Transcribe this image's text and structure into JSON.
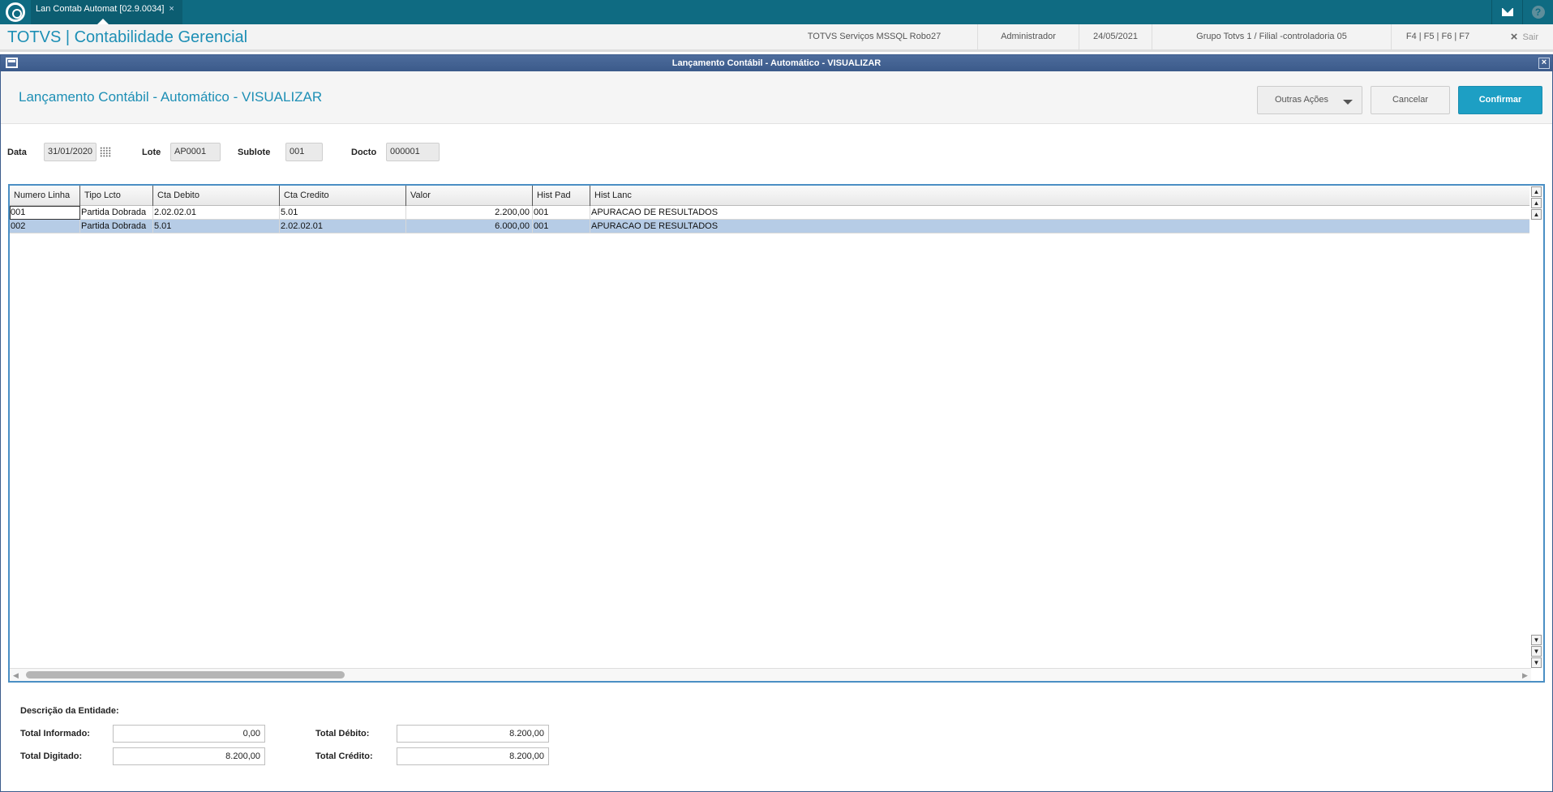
{
  "tab": {
    "label": "Lan Contab Automat [02.9.0034]",
    "close": "×"
  },
  "app": {
    "title": "TOTVS | Contabilidade Gerencial",
    "environment": "TOTVS Serviços MSSQL Robo27",
    "user": "Administrador",
    "date": "24/05/2021",
    "branch": "Grupo Totvs 1 / Filial -controladoria 05",
    "shortcuts": "F4 | F5 | F6 | F7",
    "exit_icon": "×",
    "exit_label": "Sair"
  },
  "dialog": {
    "window_title": "Lançamento Contábil - Automático - VISUALIZAR",
    "close_icon": "×",
    "heading": "Lançamento Contábil - Automático - VISUALIZAR",
    "buttons": {
      "other_actions": "Outras Ações",
      "cancel": "Cancelar",
      "confirm": "Confirmar"
    }
  },
  "fields": {
    "data_label": "Data",
    "data_value": "31/01/2020",
    "lote_label": "Lote",
    "lote_value": "AP0001",
    "sublote_label": "Sublote",
    "sublote_value": "001",
    "docto_label": "Docto",
    "docto_value": "000001"
  },
  "grid": {
    "columns": [
      "Numero Linha",
      "Tipo Lcto",
      "Cta Debito",
      "Cta Credito",
      "Valor",
      "Hist Pad",
      "Hist Lanc"
    ],
    "rows": [
      [
        "001",
        "Partida Dobrada",
        "2.02.02.01",
        "5.01",
        "2.200,00",
        "001",
        "APURACAO DE RESULTADOS"
      ],
      [
        "002",
        "Partida Dobrada",
        "5.01",
        "2.02.02.01",
        "6.000,00",
        "001",
        "APURACAO DE RESULTADOS"
      ]
    ],
    "selected_row": 1
  },
  "footer": {
    "entity_label": "Descrição da Entidade:",
    "total_informado_label": "Total Informado:",
    "total_informado": "0,00",
    "total_digitado_label": "Total Digitado:",
    "total_digitado": "8.200,00",
    "total_debito_label": "Total Débito:",
    "total_debito": "8.200,00",
    "total_credito_label": "Total Crédito:",
    "total_credito": "8.200,00"
  },
  "colors": {
    "brand": "#1d8fb5",
    "topbar": "#0f6b82",
    "confirm": "#1d9fc4",
    "selected_row": "#b6cce6"
  }
}
